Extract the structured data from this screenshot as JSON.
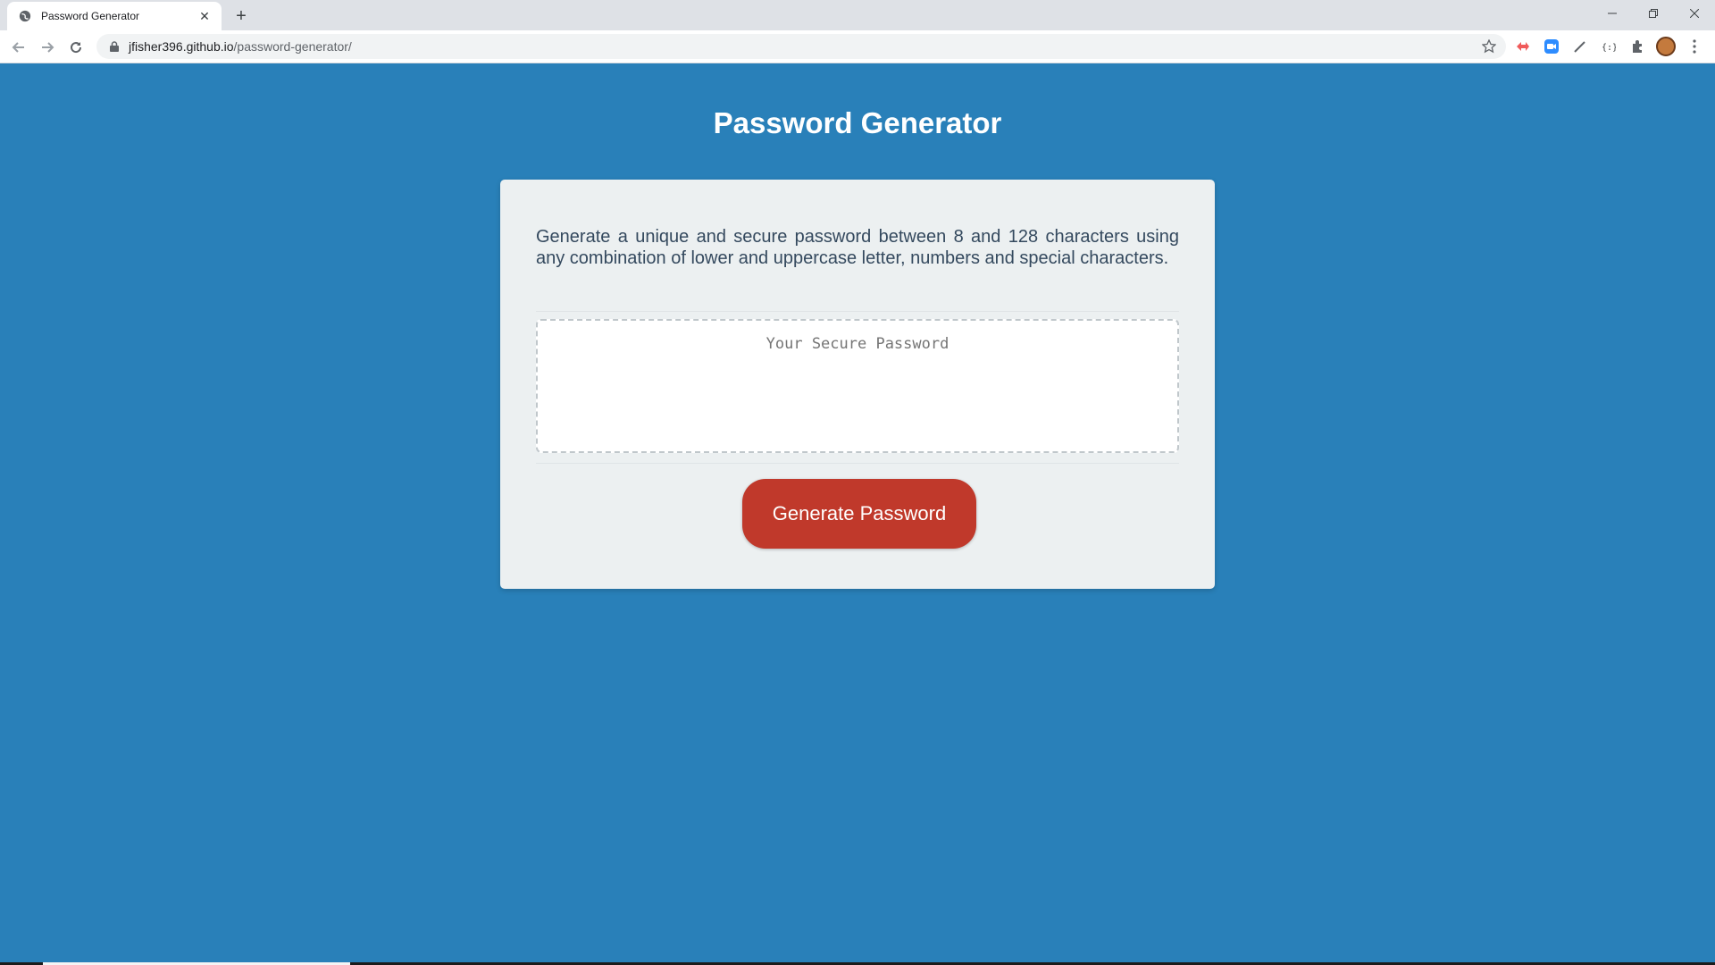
{
  "browser": {
    "tab_title": "Password Generator",
    "url_host": "jfisher396.github.io",
    "url_path": "/password-generator/",
    "icons": {
      "back": "back-arrow-icon",
      "forward": "forward-arrow-icon",
      "reload": "reload-icon",
      "lock": "lock-icon",
      "star": "star-icon",
      "extensions": [
        "red-extension-icon",
        "zoom-extension-icon",
        "eyedropper-extension-icon",
        "json-extension-icon",
        "puzzle-icon"
      ],
      "menu": "kebab-menu-icon"
    }
  },
  "page": {
    "title": "Password Generator",
    "description": "Generate a unique and secure password between 8 and 128 characters using any combination of lower and uppercase letter, numbers and special characters.",
    "password_placeholder": "Your Secure Password",
    "password_value": "",
    "generate_label": "Generate Password"
  },
  "colors": {
    "background": "#2980b9",
    "card": "#ecf0f1",
    "button": "#c0392b",
    "text": "#34495e"
  }
}
